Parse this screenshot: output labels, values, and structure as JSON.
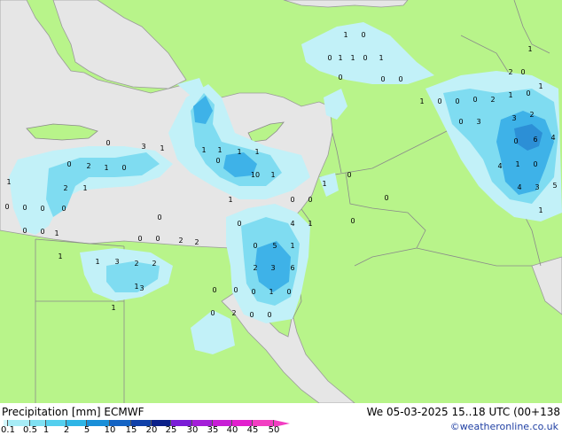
{
  "title": {
    "left": "Precipitation [mm]",
    "model": "ECMWF",
    "datetime": "We 05-03-2025 15..18 UTC (00+138"
  },
  "copyright": "©weatheronline.co.uk",
  "legend": {
    "ticks": [
      "0.1",
      "0.5",
      "1",
      "2",
      "5",
      "10",
      "15",
      "20",
      "25",
      "30",
      "35",
      "40",
      "45",
      "50"
    ],
    "colors": [
      "#d5f7fb",
      "#a7ecf6",
      "#7fe0f2",
      "#54cfee",
      "#2eb5e6",
      "#1a8fd8",
      "#1464c4",
      "#1040a8",
      "#0a1f88",
      "#7a1dd6",
      "#a41fd8",
      "#c81fd6",
      "#e21fce",
      "#f23ec2"
    ]
  },
  "colors": {
    "land": "#b8f48a",
    "sea": "#e6e6e6",
    "border": "#8a8a8a",
    "precip_light": "#c2f1f8",
    "precip_mid": "#7fdcf1",
    "precip_heavy": "#3eb2e8"
  },
  "map_labels": [
    "1",
    "0",
    "0",
    "1",
    "1",
    "0",
    "1",
    "0",
    "0",
    "0",
    "1",
    "0",
    "0",
    "0",
    "2",
    "1",
    "0",
    "1",
    "2",
    "0",
    "1",
    "0",
    "3",
    "3",
    "2",
    "0",
    "6",
    "4",
    "4",
    "1",
    "0",
    "4",
    "3",
    "5",
    "1",
    "3",
    "1",
    "1",
    "1",
    "1",
    "1",
    "10",
    "1",
    "0",
    "0",
    "0",
    "1",
    "0",
    "0",
    "0",
    "5",
    "1",
    "2",
    "3",
    "6",
    "4",
    "1",
    "0",
    "0",
    "0",
    "0",
    "0",
    "0",
    "2",
    "0",
    "1",
    "0",
    "1",
    "3",
    "2",
    "2",
    "1",
    "1",
    "0",
    "0",
    "1",
    "0",
    "0",
    "0",
    "0",
    "2",
    "1",
    "2",
    "1",
    "0",
    "0",
    "0",
    "1",
    "1",
    "0",
    "0",
    "2",
    "2",
    "0",
    "3",
    "0",
    "1"
  ]
}
